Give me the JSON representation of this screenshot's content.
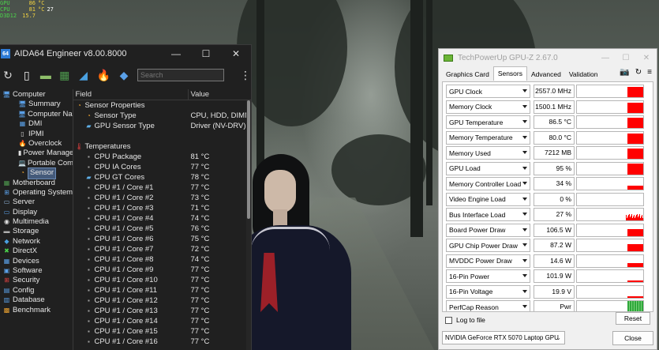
{
  "osd": {
    "rows": [
      {
        "k": "GPU",
        "v": "86",
        "u": "°C",
        "w": ""
      },
      {
        "k": "CPU",
        "v": "81",
        "u": "°C",
        "w": "27"
      },
      {
        "k": "",
        "v": "",
        "u": "",
        "w": ""
      },
      {
        "k": "D3D12",
        "v": "15.7",
        "u": "",
        "w": ""
      }
    ]
  },
  "aida": {
    "badge": "64",
    "title": "AIDA64 Engineer v8.00.8000",
    "search_placeholder": "Search",
    "tree": [
      {
        "label": "Computer",
        "level": 0,
        "expander": "⌄",
        "icon": "computer-icon",
        "glyph": "🖥"
      },
      {
        "label": "Summary",
        "level": 1,
        "icon": "summary-icon",
        "glyph": "🖥"
      },
      {
        "label": "Computer Name",
        "level": 1,
        "icon": "computer-name-icon",
        "glyph": "🖥"
      },
      {
        "label": "DMI",
        "level": 1,
        "icon": "dmi-icon",
        "glyph": "▦"
      },
      {
        "label": "IPMI",
        "level": 1,
        "icon": "ipmi-icon",
        "glyph": "▯"
      },
      {
        "label": "Overclock",
        "level": 1,
        "icon": "overclock-icon",
        "glyph": "🔥"
      },
      {
        "label": "Power Management",
        "level": 1,
        "icon": "power-management-icon",
        "glyph": "▮"
      },
      {
        "label": "Portable Computer",
        "level": 1,
        "icon": "portable-computer-icon",
        "glyph": "💻"
      },
      {
        "label": "Sensor",
        "level": 1,
        "icon": "sensor-icon",
        "glyph": "◔",
        "selected": true
      },
      {
        "label": "Motherboard",
        "level": 0,
        "expander": "›",
        "icon": "motherboard-icon",
        "glyph": "▦"
      },
      {
        "label": "Operating System",
        "level": 0,
        "expander": "›",
        "icon": "operating-system-icon",
        "glyph": "⊞"
      },
      {
        "label": "Server",
        "level": 0,
        "expander": "›",
        "icon": "server-icon",
        "glyph": "▭"
      },
      {
        "label": "Display",
        "level": 0,
        "expander": "›",
        "icon": "display-icon",
        "glyph": "▭"
      },
      {
        "label": "Multimedia",
        "level": 0,
        "expander": "›",
        "icon": "multimedia-icon",
        "glyph": "◉"
      },
      {
        "label": "Storage",
        "level": 0,
        "expander": "›",
        "icon": "storage-icon",
        "glyph": "▬"
      },
      {
        "label": "Network",
        "level": 0,
        "expander": "›",
        "icon": "network-icon",
        "glyph": "◆"
      },
      {
        "label": "DirectX",
        "level": 0,
        "expander": "›",
        "icon": "directx-icon",
        "glyph": "✖"
      },
      {
        "label": "Devices",
        "level": 0,
        "expander": "›",
        "icon": "devices-icon",
        "glyph": "▦"
      },
      {
        "label": "Software",
        "level": 0,
        "expander": "›",
        "icon": "software-icon",
        "glyph": "▣"
      },
      {
        "label": "Security",
        "level": 0,
        "expander": "›",
        "icon": "security-icon",
        "glyph": "⊞"
      },
      {
        "label": "Config",
        "level": 0,
        "expander": "›",
        "icon": "config-icon",
        "glyph": "▤"
      },
      {
        "label": "Database",
        "level": 0,
        "expander": "›",
        "icon": "database-icon",
        "glyph": "▥"
      },
      {
        "label": "Benchmark",
        "level": 0,
        "expander": "›",
        "icon": "benchmark-icon",
        "glyph": "▩"
      }
    ],
    "list": {
      "col_field": "Field",
      "col_value": "Value",
      "rows": [
        {
          "type": "sec",
          "field": "Sensor Properties",
          "value": "",
          "icon": "sensor-properties-icon",
          "glyph": "◔",
          "color": "#e8a030"
        },
        {
          "type": "sub",
          "field": "Sensor Type",
          "value": "CPU, HDD, DIMM",
          "icon": "sensor-type-icon",
          "glyph": "◔",
          "color": "#e8a030"
        },
        {
          "type": "sub",
          "field": "GPU Sensor Type",
          "value": "Driver  (NV-DRV)",
          "icon": "gpu-sensor-type-icon",
          "glyph": "▰",
          "color": "#5fb0e8"
        },
        {
          "type": "gap",
          "field": "",
          "value": ""
        },
        {
          "type": "sec",
          "field": "Temperatures",
          "value": "",
          "icon": "temperatures-icon",
          "glyph": "🌡",
          "color": "#e04040"
        },
        {
          "type": "sub",
          "field": "CPU Package",
          "value": "81 °C",
          "icon": "cpu-icon",
          "glyph": "▪",
          "color": "#a0a0a0"
        },
        {
          "type": "sub",
          "field": "CPU IA Cores",
          "value": "77 °C",
          "icon": "cpu-icon",
          "glyph": "▪",
          "color": "#a0a0a0"
        },
        {
          "type": "sub",
          "field": "CPU GT Cores",
          "value": "78 °C",
          "icon": "gpu-icon",
          "glyph": "▰",
          "color": "#5fb0e8"
        },
        {
          "type": "sub",
          "field": "CPU #1 / Core #1",
          "value": "77 °C",
          "icon": "cpu-icon",
          "glyph": "▪",
          "color": "#a0a0a0"
        },
        {
          "type": "sub",
          "field": "CPU #1 / Core #2",
          "value": "73 °C",
          "icon": "cpu-icon",
          "glyph": "▪",
          "color": "#a0a0a0"
        },
        {
          "type": "sub",
          "field": "CPU #1 / Core #3",
          "value": "71 °C",
          "icon": "cpu-icon",
          "glyph": "▪",
          "color": "#a0a0a0"
        },
        {
          "type": "sub",
          "field": "CPU #1 / Core #4",
          "value": "74 °C",
          "icon": "cpu-icon",
          "glyph": "▪",
          "color": "#a0a0a0"
        },
        {
          "type": "sub",
          "field": "CPU #1 / Core #5",
          "value": "76 °C",
          "icon": "cpu-icon",
          "glyph": "▪",
          "color": "#a0a0a0"
        },
        {
          "type": "sub",
          "field": "CPU #1 / Core #6",
          "value": "75 °C",
          "icon": "cpu-icon",
          "glyph": "▪",
          "color": "#a0a0a0"
        },
        {
          "type": "sub",
          "field": "CPU #1 / Core #7",
          "value": "72 °C",
          "icon": "cpu-icon",
          "glyph": "▪",
          "color": "#a0a0a0"
        },
        {
          "type": "sub",
          "field": "CPU #1 / Core #8",
          "value": "74 °C",
          "icon": "cpu-icon",
          "glyph": "▪",
          "color": "#a0a0a0"
        },
        {
          "type": "sub",
          "field": "CPU #1 / Core #9",
          "value": "77 °C",
          "icon": "cpu-icon",
          "glyph": "▪",
          "color": "#a0a0a0"
        },
        {
          "type": "sub",
          "field": "CPU #1 / Core #10",
          "value": "77 °C",
          "icon": "cpu-icon",
          "glyph": "▪",
          "color": "#a0a0a0"
        },
        {
          "type": "sub",
          "field": "CPU #1 / Core #11",
          "value": "77 °C",
          "icon": "cpu-icon",
          "glyph": "▪",
          "color": "#a0a0a0"
        },
        {
          "type": "sub",
          "field": "CPU #1 / Core #12",
          "value": "77 °C",
          "icon": "cpu-icon",
          "glyph": "▪",
          "color": "#a0a0a0"
        },
        {
          "type": "sub",
          "field": "CPU #1 / Core #13",
          "value": "77 °C",
          "icon": "cpu-icon",
          "glyph": "▪",
          "color": "#a0a0a0"
        },
        {
          "type": "sub",
          "field": "CPU #1 / Core #14",
          "value": "77 °C",
          "icon": "cpu-icon",
          "glyph": "▪",
          "color": "#a0a0a0"
        },
        {
          "type": "sub",
          "field": "CPU #1 / Core #15",
          "value": "77 °C",
          "icon": "cpu-icon",
          "glyph": "▪",
          "color": "#a0a0a0"
        },
        {
          "type": "sub",
          "field": "CPU #1 / Core #16",
          "value": "77 °C",
          "icon": "cpu-icon",
          "glyph": "▪",
          "color": "#a0a0a0"
        }
      ]
    }
  },
  "gpuz": {
    "title": "TechPowerUp GPU-Z 2.67.0",
    "tabs": [
      {
        "label": "Graphics Card",
        "active": false
      },
      {
        "label": "Sensors",
        "active": true
      },
      {
        "label": "Advanced",
        "active": false
      },
      {
        "label": "Validation",
        "active": false
      }
    ],
    "sensors": [
      {
        "name": "GPU Clock",
        "value": "2557.0 MHz",
        "level": 0.85,
        "graph": "solid"
      },
      {
        "name": "Memory Clock",
        "value": "1500.1 MHz",
        "level": 0.85,
        "graph": "solid"
      },
      {
        "name": "GPU Temperature",
        "value": "86.5 °C",
        "level": 0.85,
        "graph": "solid"
      },
      {
        "name": "Memory Temperature",
        "value": "80.0 °C",
        "level": 0.85,
        "graph": "solid"
      },
      {
        "name": "Memory Used",
        "value": "7212 MB",
        "level": 0.85,
        "graph": "solid"
      },
      {
        "name": "GPU Load",
        "value": "95 %",
        "level": 0.95,
        "graph": "solid"
      },
      {
        "name": "Memory Controller Load",
        "value": "34 %",
        "level": 0.34,
        "graph": "solid"
      },
      {
        "name": "Video Engine Load",
        "value": "0 %",
        "level": 0,
        "graph": "none"
      },
      {
        "name": "Bus Interface Load",
        "value": "27 %",
        "level": 0.6,
        "graph": "spiky"
      },
      {
        "name": "Board Power Draw",
        "value": "106.5 W",
        "level": 0.6,
        "graph": "solid"
      },
      {
        "name": "GPU Chip Power Draw",
        "value": "87.2 W",
        "level": 0.6,
        "graph": "solid"
      },
      {
        "name": "MVDDC Power Draw",
        "value": "14.6 W",
        "level": 0.3,
        "graph": "solid"
      },
      {
        "name": "16-Pin Power",
        "value": "101.9 W",
        "level": 0.15,
        "graph": "solid"
      },
      {
        "name": "16-Pin Voltage",
        "value": "19.9 V",
        "level": 0.1,
        "graph": "solid"
      },
      {
        "name": "PerfCap Reason",
        "value": "Pwr",
        "level": 1,
        "graph": "perfcap"
      }
    ],
    "log_label": "Log to file",
    "reset_label": "Reset",
    "gpu_name": "NVIDIA GeForce RTX 5070 Laptop GPU",
    "close_label": "Close"
  },
  "colors": {
    "graph_red": "#ff0000",
    "perfcap_green": "#2ea83a",
    "selection": "#445a7a"
  }
}
